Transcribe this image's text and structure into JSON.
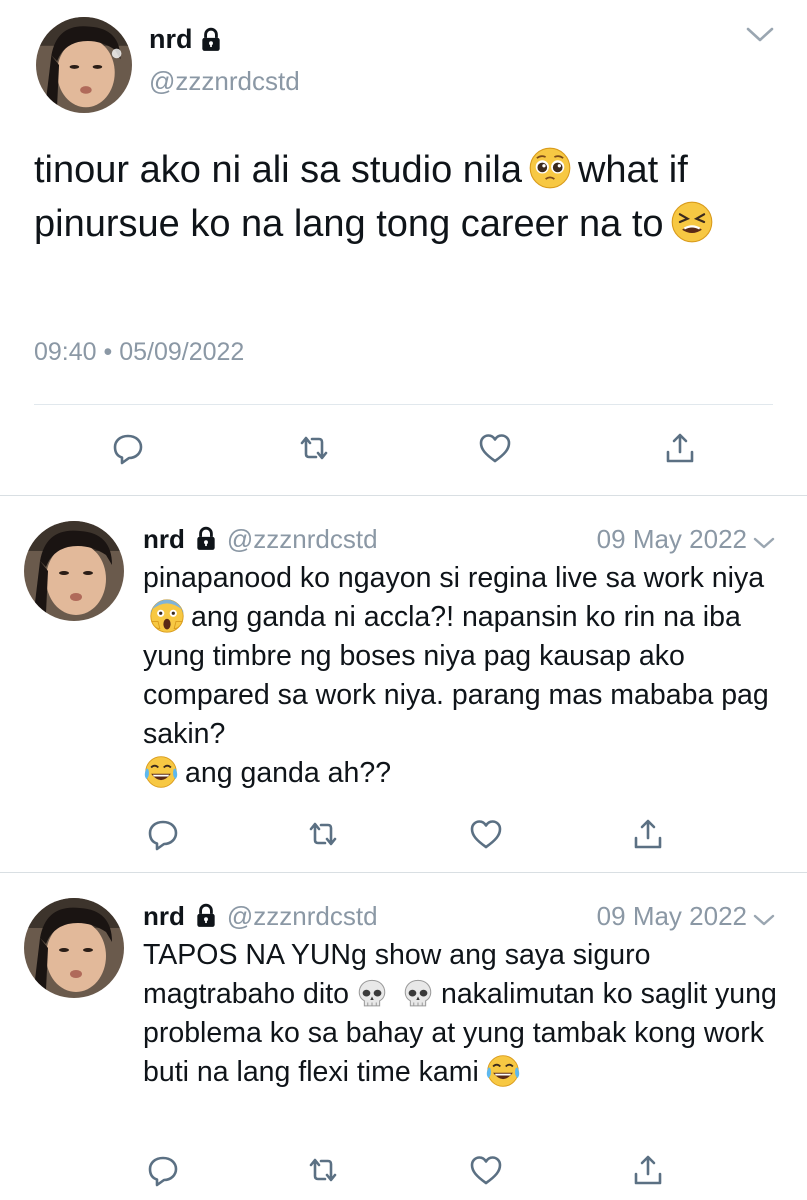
{
  "main_tweet": {
    "name": "nrd",
    "handle": "@zzznrdcstd",
    "text_parts": [
      "tinour ako ni ali sa studio nila",
      "what if pinursue ko na lang tong career na to"
    ],
    "emoji_1": "pleading-face",
    "emoji_2": "tired-face",
    "timestamp": "09:40 • 05/09/2022"
  },
  "replies": [
    {
      "name": "nrd",
      "handle": "@zzznrdcstd",
      "date": "09 May 2022",
      "text_parts": [
        "pinapanood ko ngayon si regina live sa work niya",
        "ang ganda ni accla?! napansin ko rin na iba yung timbre ng boses niya pag kausap ako compared sa work niya. parang mas mababa pag sakin?",
        "ang ganda ah??"
      ],
      "emoji_1": "screaming-face",
      "emoji_2": "tears-of-joy-face"
    },
    {
      "name": "nrd",
      "handle": "@zzznrdcstd",
      "date": "09 May 2022",
      "text_parts": [
        "TAPOS NA YUNg show ang saya siguro magtrabaho dito",
        "nakalimutan ko saglit yung problema ko sa bahay at yung tambak kong work buti na lang flexi time kami"
      ],
      "emoji_1": "skull",
      "emoji_2": "skull",
      "emoji_3": "tears-of-joy-face"
    }
  ],
  "icons": {
    "reply": "reply-icon",
    "retweet": "retweet-icon",
    "like": "heart-icon",
    "share": "share-icon",
    "lock": "lock-icon",
    "more": "chevron-down-icon"
  },
  "colors": {
    "text": "#0f1419",
    "secondary": "#8b98a5",
    "icon": "#5b7083",
    "separator": "#e1e8ed"
  }
}
